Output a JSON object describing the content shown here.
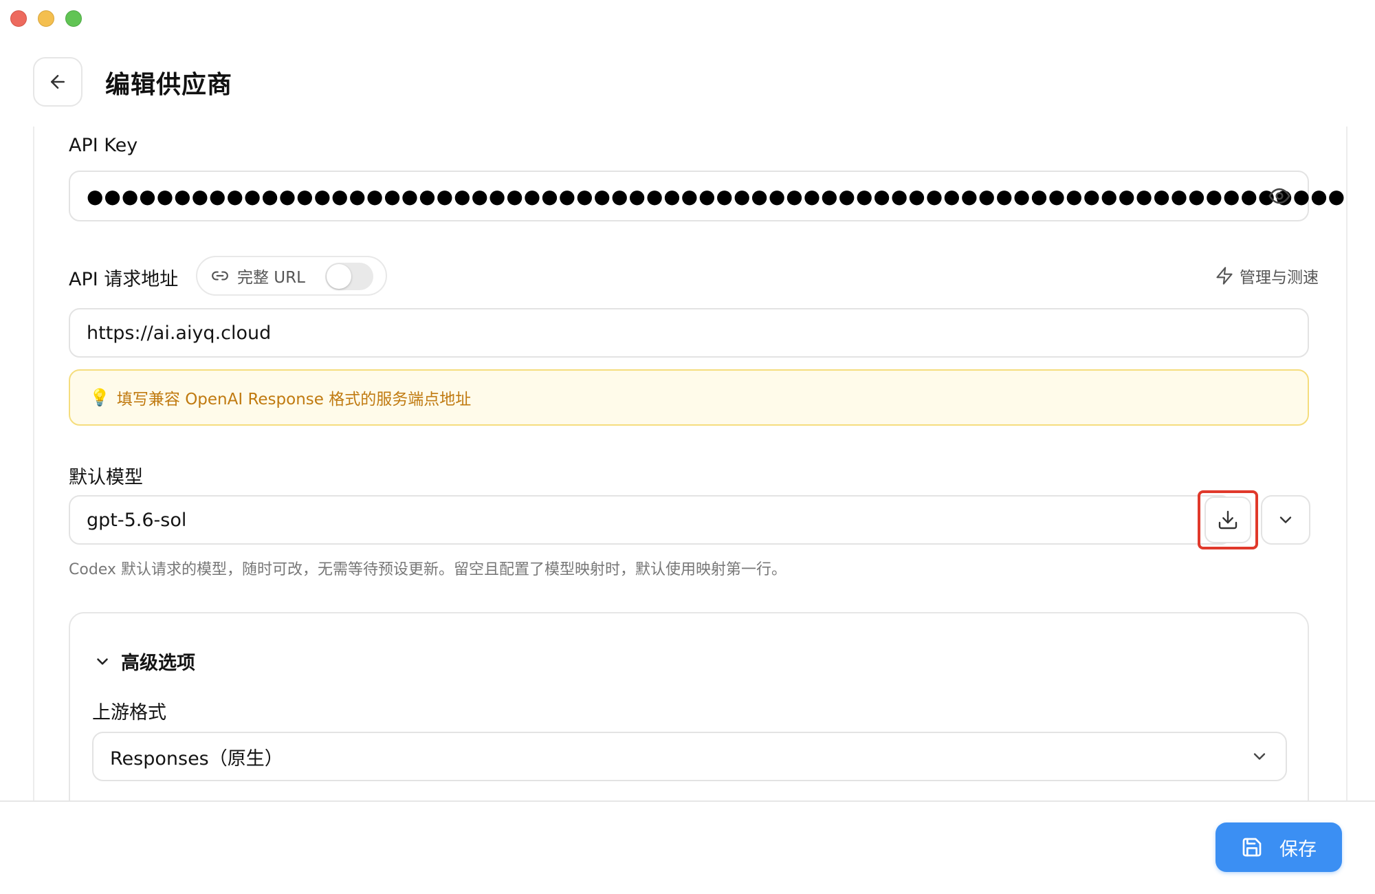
{
  "header": {
    "title": "编辑供应商"
  },
  "api_key": {
    "label": "API Key",
    "masked_value": "●●●●●●●●●●●●●●●●●●●●●●●●●●●●●●●●●●●●●●●●●●●●●●●●●●●●●●●●●●●●●●●●●●●●●●●●●●●"
  },
  "api_url": {
    "label": "API 请求地址",
    "full_url_label": "完整 URL",
    "full_url_enabled": false,
    "manage_label": "管理与测速",
    "value": "https://ai.aiyq.cloud",
    "tip_icon": "💡",
    "tip": "填写兼容 OpenAI Response 格式的服务端点地址"
  },
  "default_model": {
    "label": "默认模型",
    "value": "gpt-5.6-sol",
    "hint": "Codex 默认请求的模型，随时可改，无需等待预设更新。留空且配置了模型映射时，默认使用映射第一行。"
  },
  "advanced": {
    "title": "高级选项",
    "upstream_label": "上游格式",
    "upstream_value": "Responses（原生）"
  },
  "footer": {
    "save_label": "保存"
  },
  "colors": {
    "accent": "#3b8ff3",
    "highlight_box": "#e0392b",
    "tip_bg": "#fffbea",
    "tip_text": "#c07a10"
  }
}
